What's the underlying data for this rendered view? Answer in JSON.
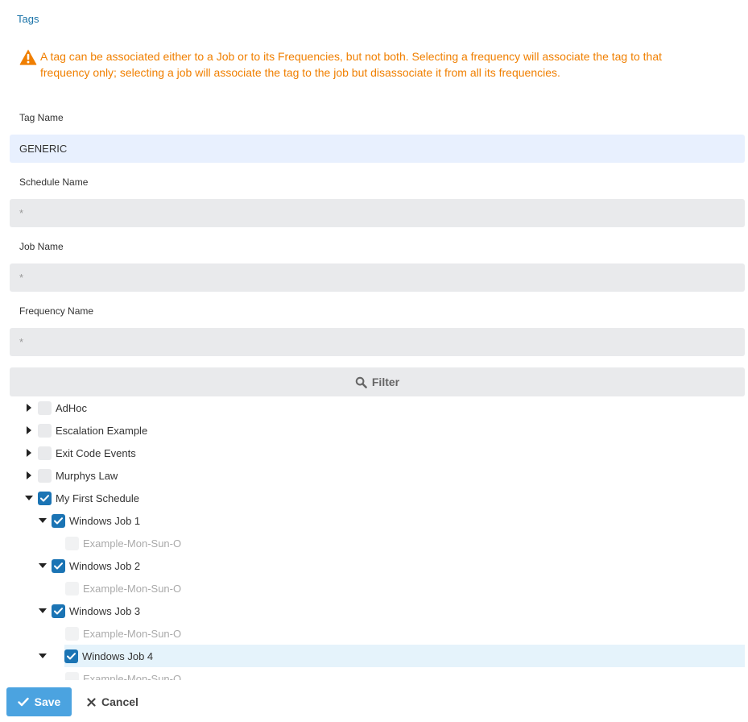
{
  "header": {
    "tags_link": "Tags"
  },
  "warning": {
    "icon": "warning-triangle-icon",
    "color": "#f07f00",
    "text": "A tag can be associated either to a Job or to its Frequencies, but not both. Selecting a frequency will associate the tag to that frequency only; selecting a job will associate the tag to the job but disassociate it from all its frequencies."
  },
  "form": {
    "tag_name": {
      "label": "Tag Name",
      "value": "GENERIC"
    },
    "schedule_name": {
      "label": "Schedule Name",
      "value": "*"
    },
    "job_name": {
      "label": "Job Name",
      "value": "*"
    },
    "frequency_name": {
      "label": "Frequency Name",
      "value": "*"
    }
  },
  "filter": {
    "label": "Filter",
    "icon": "search-icon"
  },
  "tree": {
    "nodes": [
      {
        "label": "AdHoc",
        "level": 0,
        "expanded": false,
        "checked": false
      },
      {
        "label": "Escalation Example",
        "level": 0,
        "expanded": false,
        "checked": false
      },
      {
        "label": "Exit Code Events",
        "level": 0,
        "expanded": false,
        "checked": false
      },
      {
        "label": "Murphys Law",
        "level": 0,
        "expanded": false,
        "checked": false
      },
      {
        "label": "My First Schedule",
        "level": 0,
        "expanded": true,
        "checked": true
      },
      {
        "label": "Windows Job 1",
        "level": 1,
        "expanded": true,
        "checked": true
      },
      {
        "label": "Example-Mon-Sun-O",
        "level": 2,
        "checked": false,
        "disabled": true
      },
      {
        "label": "Windows Job 2",
        "level": 1,
        "expanded": true,
        "checked": true
      },
      {
        "label": "Example-Mon-Sun-O",
        "level": 2,
        "checked": false,
        "disabled": true
      },
      {
        "label": "Windows Job 3",
        "level": 1,
        "expanded": true,
        "checked": true
      },
      {
        "label": "Example-Mon-Sun-O",
        "level": 2,
        "checked": false,
        "disabled": true
      },
      {
        "label": "Windows Job 4",
        "level": 1,
        "expanded": true,
        "checked": true,
        "selected": true
      },
      {
        "label": "Example-Mon-Sun-O",
        "level": 2,
        "checked": false,
        "disabled": true
      }
    ]
  },
  "actions": {
    "save_label": "Save",
    "cancel_label": "Cancel"
  },
  "colors": {
    "accent": "#1b74b4",
    "save_button": "#4ba3e0",
    "link": "#1a73a8",
    "selected_row": "#e5f3fb"
  }
}
